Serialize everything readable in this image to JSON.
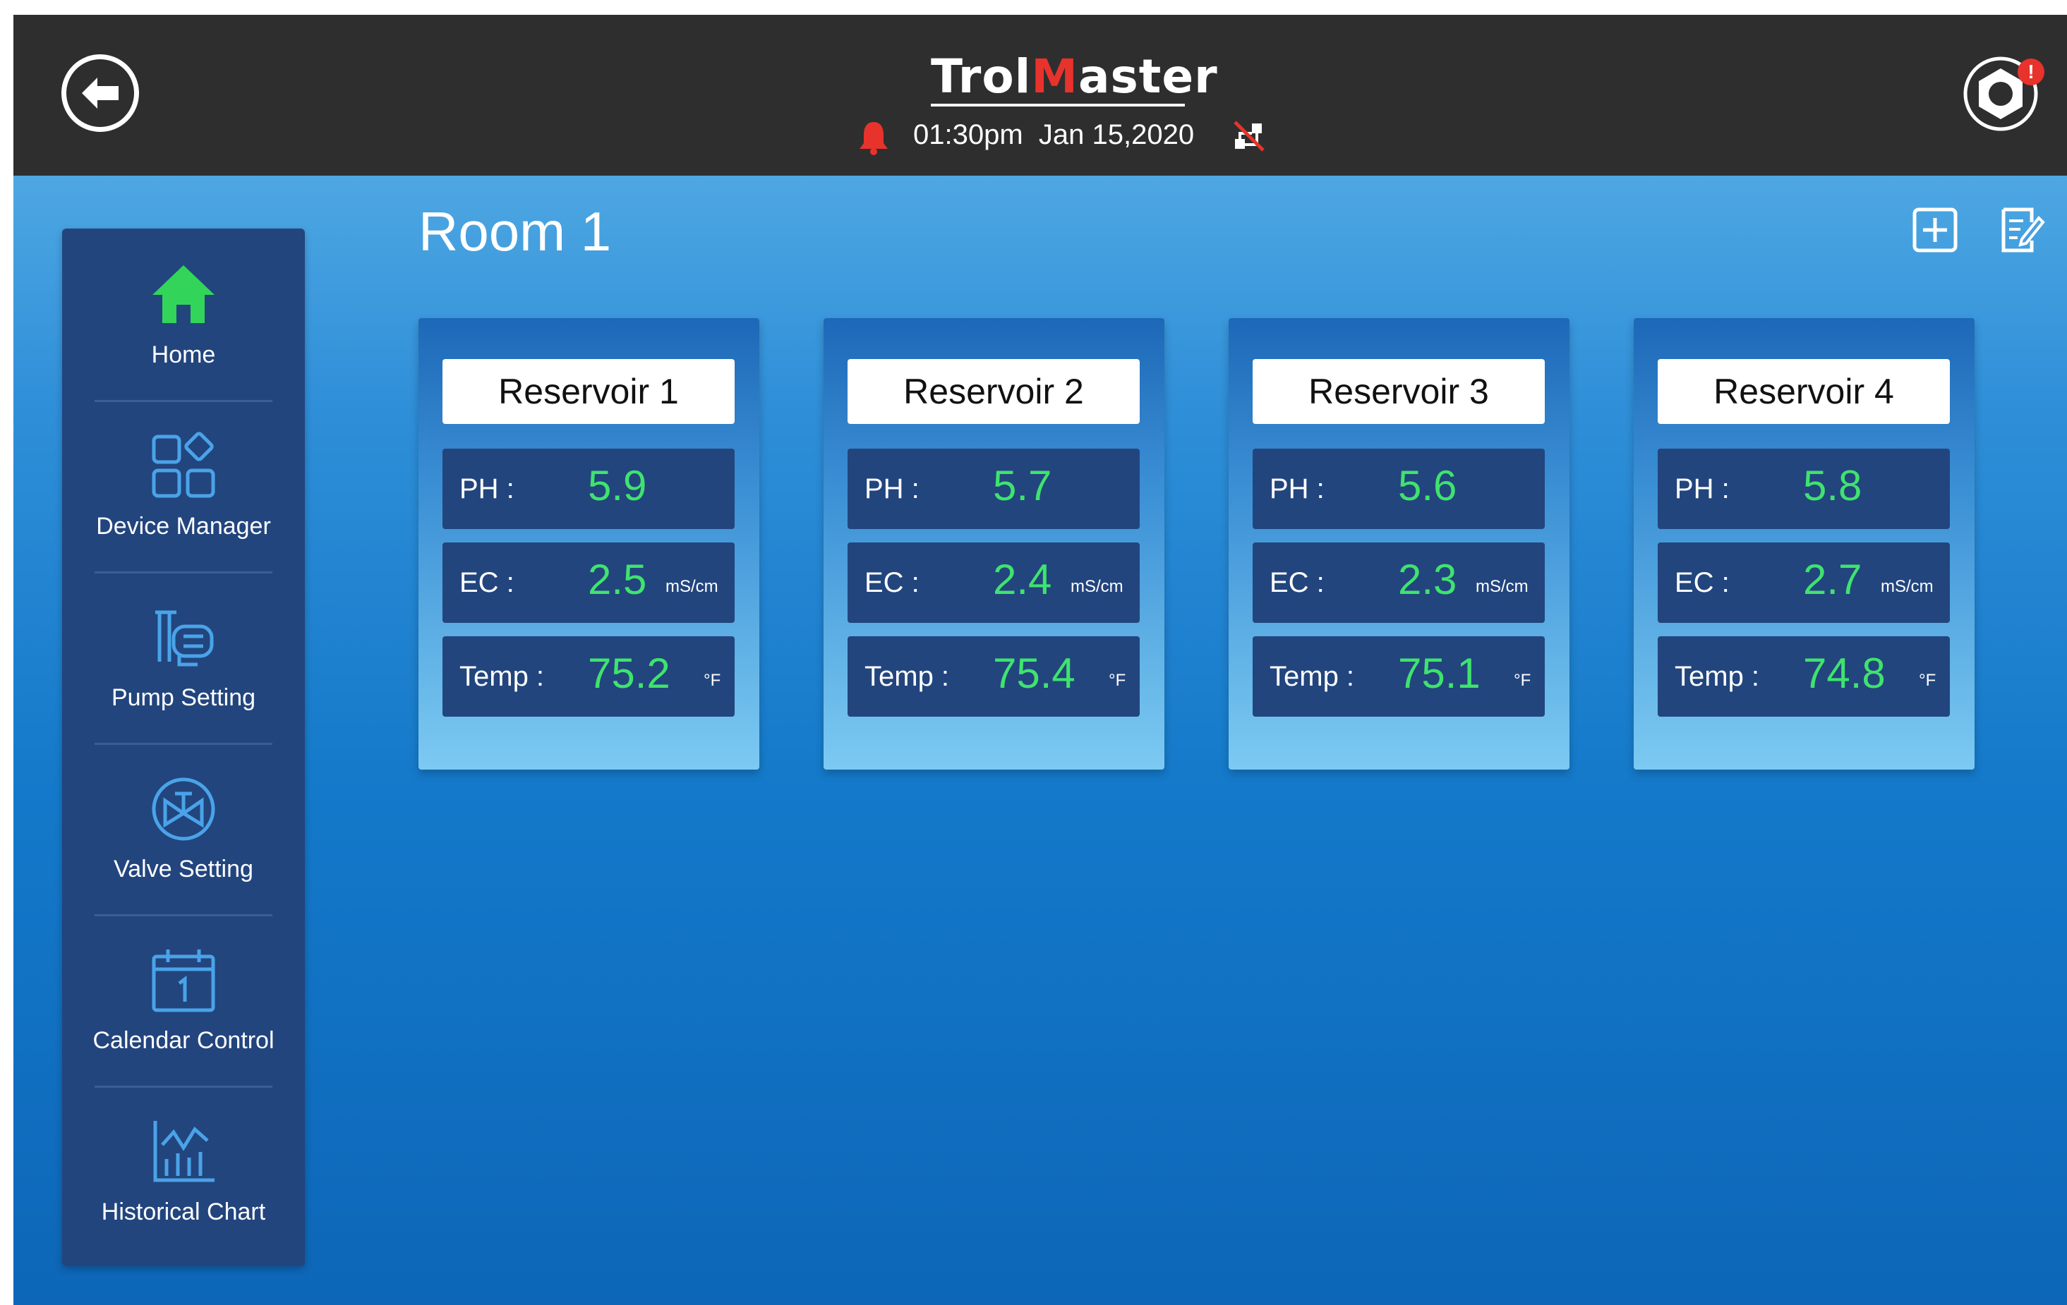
{
  "header": {
    "brand_prefix": "Trol",
    "brand_accent": "M",
    "brand_suffix": "aster",
    "time": "01:30pm",
    "date": "Jan 15,2020",
    "alert_badge": "!",
    "icons": {
      "back": "back-arrow-icon",
      "bell": "bell-icon",
      "network": "network-disconnected-icon",
      "settings": "settings-gear-icon"
    }
  },
  "sidebar": {
    "items": [
      {
        "label": "Home",
        "icon": "home-icon",
        "active": true
      },
      {
        "label": "Device Manager",
        "icon": "device-manager-icon"
      },
      {
        "label": "Pump Setting",
        "icon": "pump-icon"
      },
      {
        "label": "Valve Setting",
        "icon": "valve-icon"
      },
      {
        "label": "Calendar Control",
        "icon": "calendar-icon"
      },
      {
        "label": "Historical Chart",
        "icon": "chart-icon"
      }
    ]
  },
  "main": {
    "room_title": "Room 1",
    "actions": {
      "add": "add-icon",
      "edit": "edit-note-icon"
    },
    "reservoirs": [
      {
        "name": "Reservoir 1",
        "ph_label": "PH :",
        "ph": "5.9",
        "ec_label": "EC :",
        "ec": "2.5",
        "ec_unit": "mS/cm",
        "temp_label": "Temp :",
        "temp": "75.2",
        "temp_unit": "°F"
      },
      {
        "name": "Reservoir 2",
        "ph_label": "PH :",
        "ph": "5.7",
        "ec_label": "EC :",
        "ec": "2.4",
        "ec_unit": "mS/cm",
        "temp_label": "Temp :",
        "temp": "75.4",
        "temp_unit": "°F"
      },
      {
        "name": "Reservoir 3",
        "ph_label": "PH :",
        "ph": "5.6",
        "ec_label": "EC :",
        "ec": "2.3",
        "ec_unit": "mS/cm",
        "temp_label": "Temp :",
        "temp": "75.1",
        "temp_unit": "°F"
      },
      {
        "name": "Reservoir 4",
        "ph_label": "PH :",
        "ph": "5.8",
        "ec_label": "EC :",
        "ec": "2.7",
        "ec_unit": "mS/cm",
        "temp_label": "Temp :",
        "temp": "74.8",
        "temp_unit": "°F"
      }
    ]
  },
  "colors": {
    "header_bg": "#2e2e2e",
    "sidebar_bg": "#22457e",
    "value_green": "#3fe36d",
    "home_green": "#33d45a",
    "accent_red": "#e8322c",
    "icon_blue": "#4aa3e8"
  }
}
